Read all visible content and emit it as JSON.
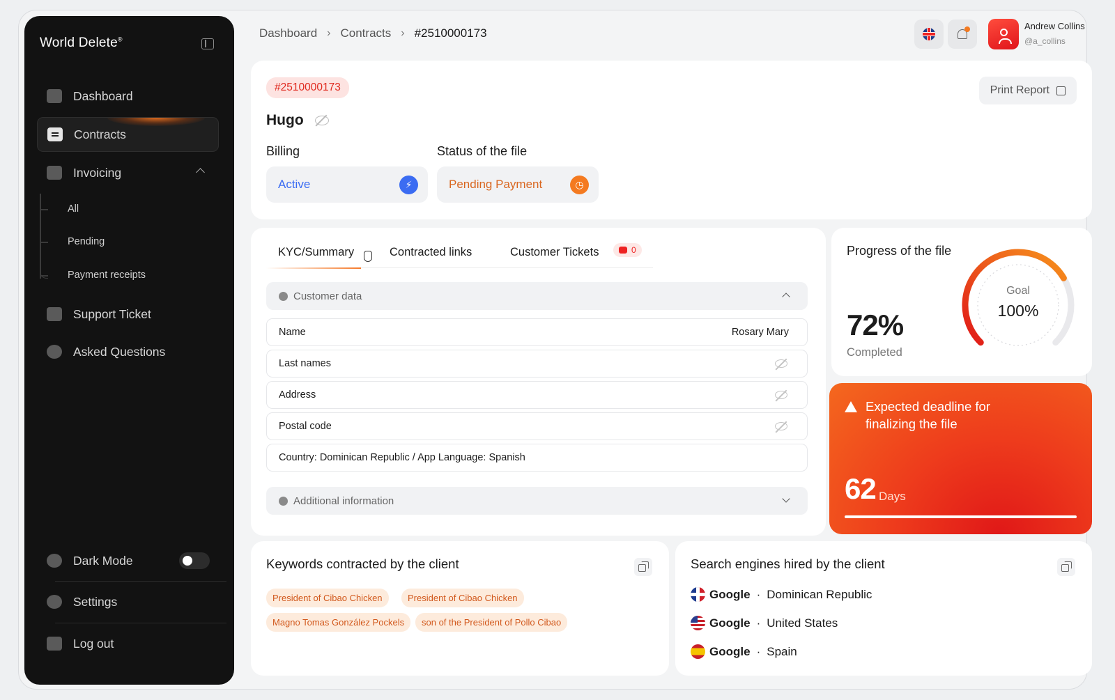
{
  "sidebar": {
    "brand": "World Delete",
    "brand_mark": "®",
    "nav": [
      {
        "label": "Dashboard"
      },
      {
        "label": "Contracts"
      },
      {
        "label": "Invoicing"
      },
      {
        "label": "Support Ticket"
      },
      {
        "label": "Asked Questions"
      }
    ],
    "invoicing_sub": [
      "All",
      "Pending",
      "Payment receipts"
    ],
    "dark_mode_label": "Dark Mode",
    "settings_label": "Settings",
    "logout_label": "Log out"
  },
  "header": {
    "breadcrumb": [
      "Dashboard",
      "Contracts",
      "#2510000173"
    ],
    "user_name": "Andrew Collins",
    "user_handle": "@a_collins"
  },
  "file": {
    "id": "#2510000173",
    "client_name": "Hugo",
    "billing_label": "Billing",
    "billing_value": "Active",
    "status_label": "Status of the file",
    "status_value": "Pending Payment",
    "print_label": "Print Report"
  },
  "tabs": {
    "items": [
      "KYC/Summary",
      "Contracted links",
      "Customer Tickets"
    ],
    "tickets_count": "0"
  },
  "customer": {
    "section_title": "Customer data",
    "rows": [
      {
        "label": "Name",
        "value": "Rosary Mary"
      },
      {
        "label": "Last names"
      },
      {
        "label": "Address"
      },
      {
        "label": "Postal code"
      }
    ],
    "country_line": "Country: Dominican Republic / App Language: Spanish",
    "additional_title": "Additional information"
  },
  "progress": {
    "title": "Progress of the file",
    "percent": "72%",
    "percent_value": 72,
    "completed_label": "Completed",
    "goal_label": "Goal",
    "goal_value": "100%"
  },
  "deadline": {
    "text": "Expected deadline for finalizing the file",
    "days": "62",
    "days_label": "Days"
  },
  "keywords": {
    "title": "Keywords contracted by the client",
    "items": [
      "President of Cibao Chicken",
      "President of Cibao Chicken",
      "Magno Tomas González Pockels",
      "son of the President of Pollo Cibao"
    ]
  },
  "engines": {
    "title": "Search engines hired by the client",
    "items": [
      {
        "engine": "Google",
        "country": "Dominican Republic"
      },
      {
        "engine": "Google",
        "country": "United States"
      },
      {
        "engine": "Google",
        "country": "Spain"
      }
    ]
  },
  "colors": {
    "accent": "#f47a20",
    "danger": "#e02a1f",
    "active_blue": "#3b6cf2",
    "pending_orange": "#d9661f"
  }
}
